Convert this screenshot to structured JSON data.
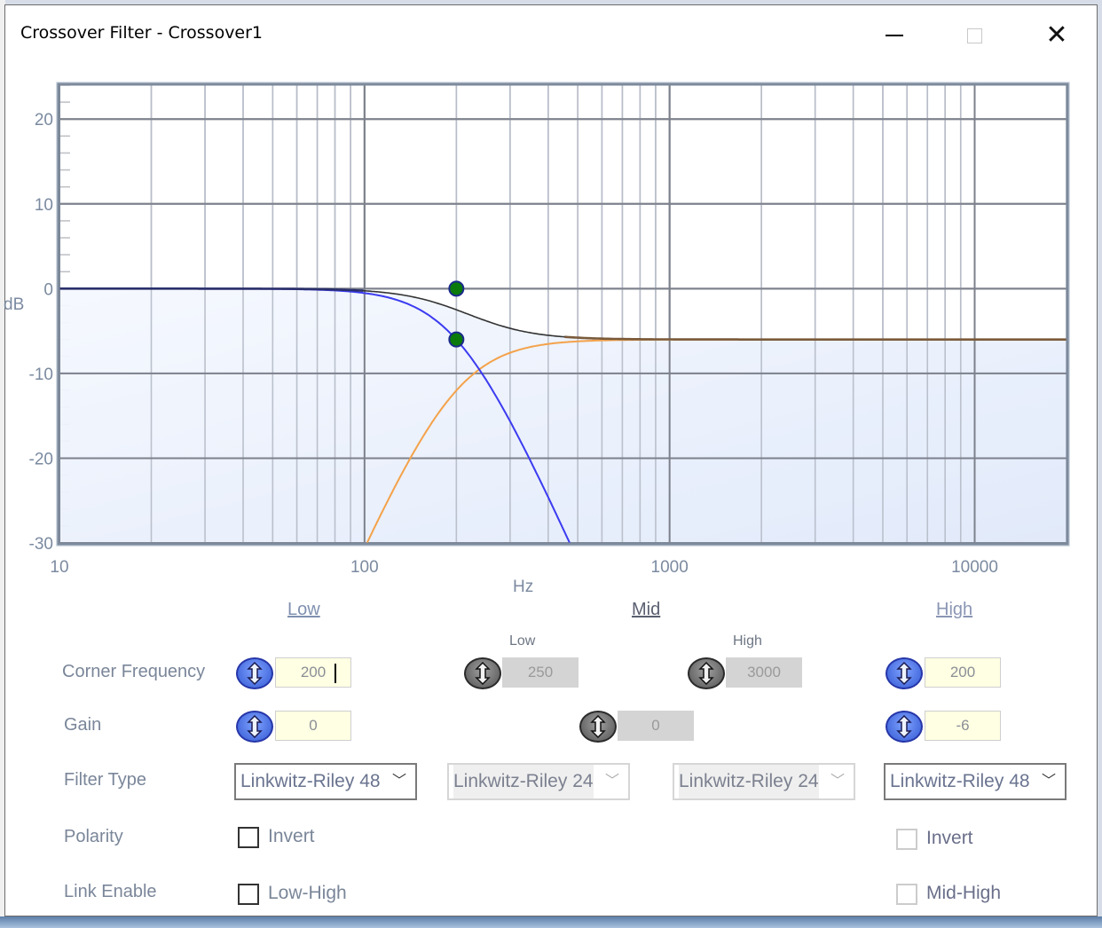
{
  "window": {
    "title": "Crossover Filter - Crossover1",
    "controls": {
      "minimize": "minimize-icon",
      "maximize": "maximize-icon",
      "close": "close-icon"
    }
  },
  "chart_data": {
    "type": "line",
    "title": "",
    "xlabel": "Hz",
    "ylabel": "dB",
    "xscale": "log",
    "xlim": [
      10,
      20000
    ],
    "ylim": [
      -30,
      24
    ],
    "x_tick_labels": [
      "10",
      "100",
      "1000",
      "10000"
    ],
    "x_ticks": [
      10,
      100,
      1000,
      10000
    ],
    "y_tick_labels": [
      "20",
      "10",
      "0",
      "-10",
      "-20",
      "-30"
    ],
    "y_ticks": [
      20,
      10,
      0,
      -10,
      -20,
      -30
    ],
    "grid": true,
    "series": [
      {
        "name": "Low (Linkwitz-Riley 48, 200 Hz, 0 dB)",
        "color": "#3b3bf0",
        "kind": "lowpass",
        "fc": 200,
        "gain": 0,
        "order": 8
      },
      {
        "name": "High (Linkwitz-Riley 48, 200 Hz, -6 dB)",
        "color": "#f4a24a",
        "kind": "highpass",
        "fc": 200,
        "gain": -6,
        "order": 8
      },
      {
        "name": "Sum",
        "color": "#333333",
        "kind": "sum"
      }
    ],
    "markers": [
      {
        "x": 200,
        "y": 0,
        "color": "#0a7a0a"
      },
      {
        "x": 200,
        "y": -6,
        "color": "#0a7a0a"
      }
    ],
    "fill_color": "#e4ecfa"
  },
  "bands": {
    "low": {
      "label": "Low"
    },
    "mid": {
      "label": "Mid",
      "sub_low": "Low",
      "sub_high": "High"
    },
    "high": {
      "label": "High"
    }
  },
  "rows": {
    "corner_frequency": "Corner Frequency",
    "gain": "Gain",
    "filter_type": "Filter Type",
    "polarity": "Polarity",
    "link_enable": "Link Enable"
  },
  "values": {
    "low_freq": "200",
    "mid_low_freq": "250",
    "mid_high_freq": "3000",
    "high_freq": "200",
    "low_gain": "0",
    "mid_gain": "0",
    "high_gain": "-6"
  },
  "filter_types": {
    "low": "Linkwitz-Riley 48",
    "mid_low": "Linkwitz-Riley 24",
    "mid_high": "Linkwitz-Riley 24",
    "high": "Linkwitz-Riley 48"
  },
  "checkboxes": {
    "low_invert": {
      "label": "Invert",
      "checked": false
    },
    "high_invert": {
      "label": "Invert",
      "checked": false
    },
    "link_low_high": {
      "label": "Low-High",
      "checked": false
    },
    "link_mid_high": {
      "label": "Mid-High",
      "checked": false
    }
  }
}
